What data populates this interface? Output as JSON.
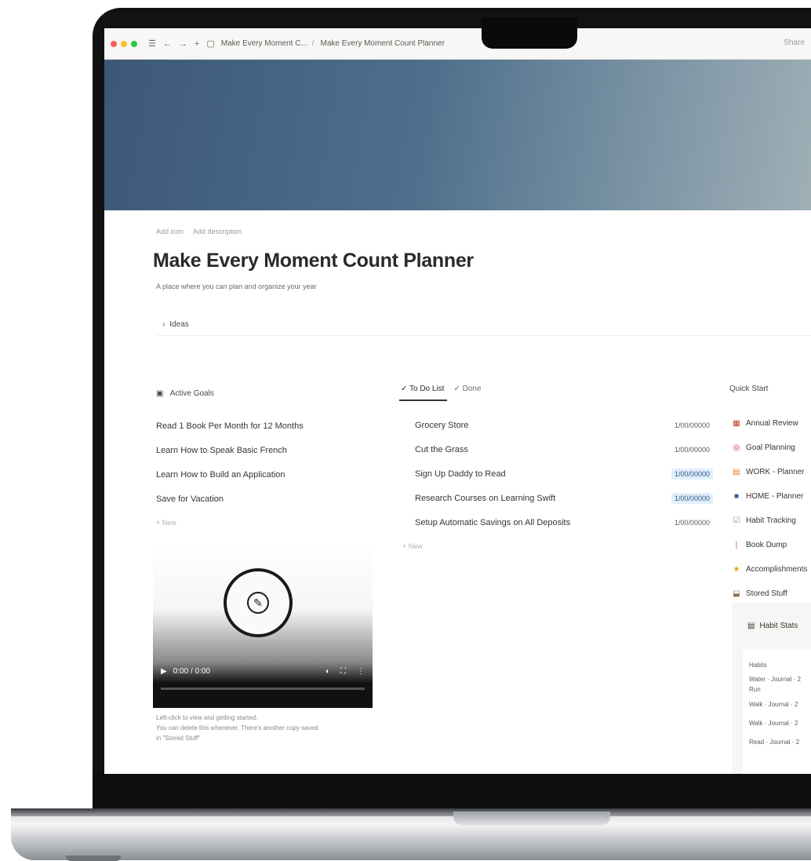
{
  "browser": {
    "tab_title": "Make Every Moment C...",
    "page_path": "Make Every Moment Count Planner",
    "share_label": "Share"
  },
  "page": {
    "actions": [
      "Add icon",
      "Add description"
    ],
    "title": "Make Every Moment Count Planner",
    "subtitle": "A place where you can plan and organize your year",
    "ideas_label": "Ideas"
  },
  "active_goals": {
    "header": "Active Goals",
    "items": [
      "Read 1 Book Per Month for 12 Months",
      "Learn How to Speak Basic French",
      "Learn How to Build an Application",
      "Save for Vacation"
    ],
    "new_label": "New"
  },
  "todo": {
    "tabs": [
      "To Do List",
      "Done"
    ],
    "items": [
      {
        "task": "Grocery Store",
        "date": "1/00/00000",
        "highlight": false
      },
      {
        "task": "Cut the Grass",
        "date": "1/00/00000",
        "highlight": false
      },
      {
        "task": "Sign Up Daddy to Read",
        "date": "1/00/00000",
        "highlight": true
      },
      {
        "task": "Research Courses on Learning Swift",
        "date": "1/00/00000",
        "highlight": true
      },
      {
        "task": "Setup Automatic Savings on All Deposits",
        "date": "1/00/00000",
        "highlight": false
      }
    ],
    "new_label": "New"
  },
  "quick_start": {
    "header": "Quick Start",
    "items": [
      {
        "label": "Annual Review",
        "icon": "calendar-icon",
        "color": "#c0392b"
      },
      {
        "label": "Goal Planning",
        "icon": "target-icon",
        "color": "#c0392b"
      },
      {
        "label": "WORK - Planner",
        "icon": "briefcase-icon",
        "color": "#e67e22"
      },
      {
        "label": "HOME - Planner",
        "icon": "home-icon",
        "color": "#2c5f9e"
      },
      {
        "label": "Habit Tracking",
        "icon": "check-icon",
        "color": "#6b9ac4"
      },
      {
        "label": "Book Dump",
        "icon": "book-icon",
        "color": "#d35b8f"
      },
      {
        "label": "Accomplishments",
        "icon": "trophy-icon",
        "color": "#e6a817"
      },
      {
        "label": "Stored Stuff",
        "icon": "box-icon",
        "color": "#8b6b4a"
      }
    ]
  },
  "video": {
    "time": "0:00 / 0:00",
    "caption_lines": [
      "Left-click to view and getting started.",
      "You can delete this whenever. There's another copy saved",
      "in \"Stored Stuff\""
    ]
  },
  "habit_stats": {
    "title": "Habit Stats",
    "rows": [
      "Habits",
      "Water · Journal · 2",
      "Run",
      "Walk · Journal · 2",
      "Walk · Journal · 2",
      "Read · Journal · 2"
    ]
  }
}
